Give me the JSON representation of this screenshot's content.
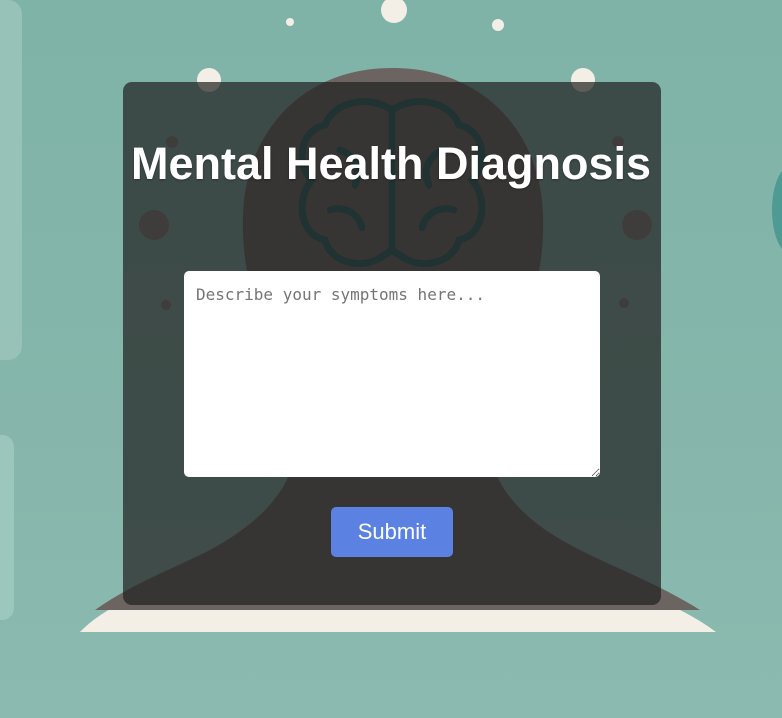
{
  "page": {
    "title": "Mental Health Diagnosis"
  },
  "form": {
    "symptoms_placeholder": "Describe your symptoms here...",
    "symptoms_value": "",
    "submit_label": "Submit"
  },
  "colors": {
    "background": "#85b5aa",
    "card": "#222222",
    "button": "#5b82e3",
    "head_silhouette": "#6b6461",
    "brain_outline": "#1f5a5a",
    "base_arc": "#f3efe6"
  },
  "icons": {
    "background_illustration": "head-with-brain-icon"
  }
}
